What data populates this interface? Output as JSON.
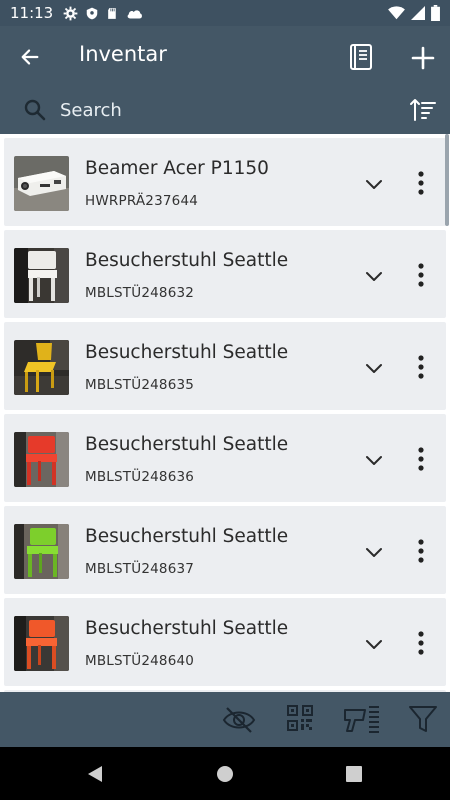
{
  "status_bar": {
    "time": "11:13",
    "left_icons": [
      "settings-icon",
      "shield-icon",
      "sd-card-icon",
      "cloud-icon"
    ],
    "right_icons": [
      "wifi-icon",
      "signal-icon",
      "battery-icon"
    ]
  },
  "app_bar": {
    "title": "Inventar",
    "icons": [
      "back-arrow-icon",
      "book-icon",
      "plus-icon"
    ]
  },
  "search": {
    "placeholder": "Search",
    "icons": [
      "search-icon",
      "sort-icon"
    ]
  },
  "items": [
    {
      "name": "Beamer Acer P1150",
      "code": "HWRPRÄ237644",
      "thumb": "projector"
    },
    {
      "name": "Besucherstuhl Seattle",
      "code": "MBLSTÜ248632",
      "thumb": "chair-white"
    },
    {
      "name": "Besucherstuhl Seattle",
      "code": "MBLSTÜ248635",
      "thumb": "chair-yellow"
    },
    {
      "name": "Besucherstuhl Seattle",
      "code": "MBLSTÜ248636",
      "thumb": "chair-red"
    },
    {
      "name": "Besucherstuhl Seattle",
      "code": "MBLSTÜ248637",
      "thumb": "chair-green"
    },
    {
      "name": "Besucherstuhl Seattle",
      "code": "MBLSTÜ248640",
      "thumb": "chair-orange"
    }
  ],
  "toolbar": {
    "icons": [
      "eye-off-icon",
      "qr-code-icon",
      "barcode-scanner-icon",
      "filter-icon"
    ]
  },
  "nav": {
    "icons": [
      "back-triangle-icon",
      "home-circle-icon",
      "recents-square-icon"
    ]
  },
  "colors": {
    "app_bar": "#445766",
    "status_bar": "#3e5161",
    "item_bg": "#eceef1"
  }
}
